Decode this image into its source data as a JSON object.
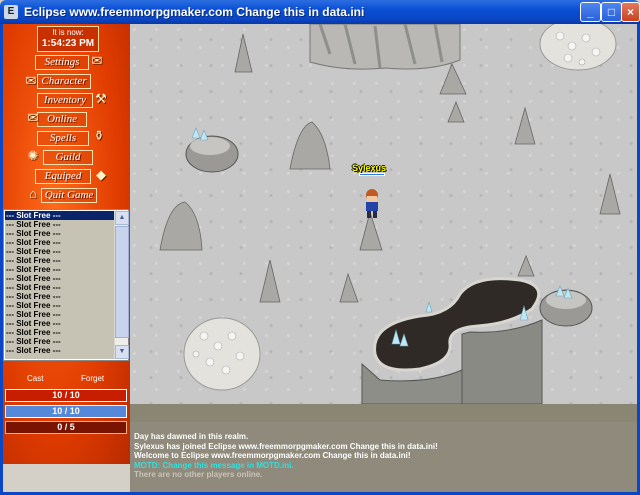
{
  "window": {
    "title": "Eclipse www.freemmorpgmaker.com Change this in data.ini",
    "icon_glyph": "E",
    "controls": {
      "minimize": "_",
      "maximize": "□",
      "close": "×"
    }
  },
  "clock": {
    "label": "It is now:",
    "time": "1:54:23 PM"
  },
  "menu": {
    "settings": "Settings",
    "character": "Character",
    "inventory": "Inventory",
    "online": "Online",
    "spells": "Spells",
    "guild": "Guild",
    "equiped": "Equiped",
    "quit": "Quit Game"
  },
  "slots": [
    "--- Slot Free ---",
    "--- Slot Free ---",
    "--- Slot Free ---",
    "--- Slot Free ---",
    "--- Slot Free ---",
    "--- Slot Free ---",
    "--- Slot Free ---",
    "--- Slot Free ---",
    "--- Slot Free ---",
    "--- Slot Free ---",
    "--- Slot Free ---",
    "--- Slot Free ---",
    "--- Slot Free ---",
    "--- Slot Free ---",
    "--- Slot Free ---",
    "--- Slot Free ---"
  ],
  "spell_actions": {
    "cast": "Cast",
    "forget": "Forget"
  },
  "stats": {
    "hp": {
      "text": "10 / 10",
      "fraction": 1.0,
      "color": "#c81e00"
    },
    "mp": {
      "text": "10 / 10",
      "fraction": 1.0,
      "color": "#5588d8"
    },
    "sp": {
      "text": "0 / 5",
      "fraction": 0.0,
      "color": "#c81e00"
    }
  },
  "player": {
    "name": "Sylexus"
  },
  "chat": [
    {
      "text": "Day has dawned in this realm.",
      "color": "#ffffff"
    },
    {
      "text": "Sylexus has joined Eclipse www.freemmorpgmaker.com Change this in data.ini!",
      "color": "#ffffff"
    },
    {
      "text": "Welcome to Eclipse www.freemmorpgmaker.com Change this in data.ini!",
      "color": "#ffffff"
    },
    {
      "text": "MOTD: Change this message in MOTD.ini.",
      "color": "#33e0e0"
    },
    {
      "text": "There are no other players online.",
      "color": "#c8c4b8"
    }
  ],
  "icons": {
    "settings": "scroll-icon",
    "character": "scroll-icon",
    "inventory": "pickaxe-icon",
    "online": "scroll-icon",
    "spells": "potion-icon",
    "guild": "shield-icon",
    "equiped": "gem-icon",
    "quit": "door-icon"
  }
}
